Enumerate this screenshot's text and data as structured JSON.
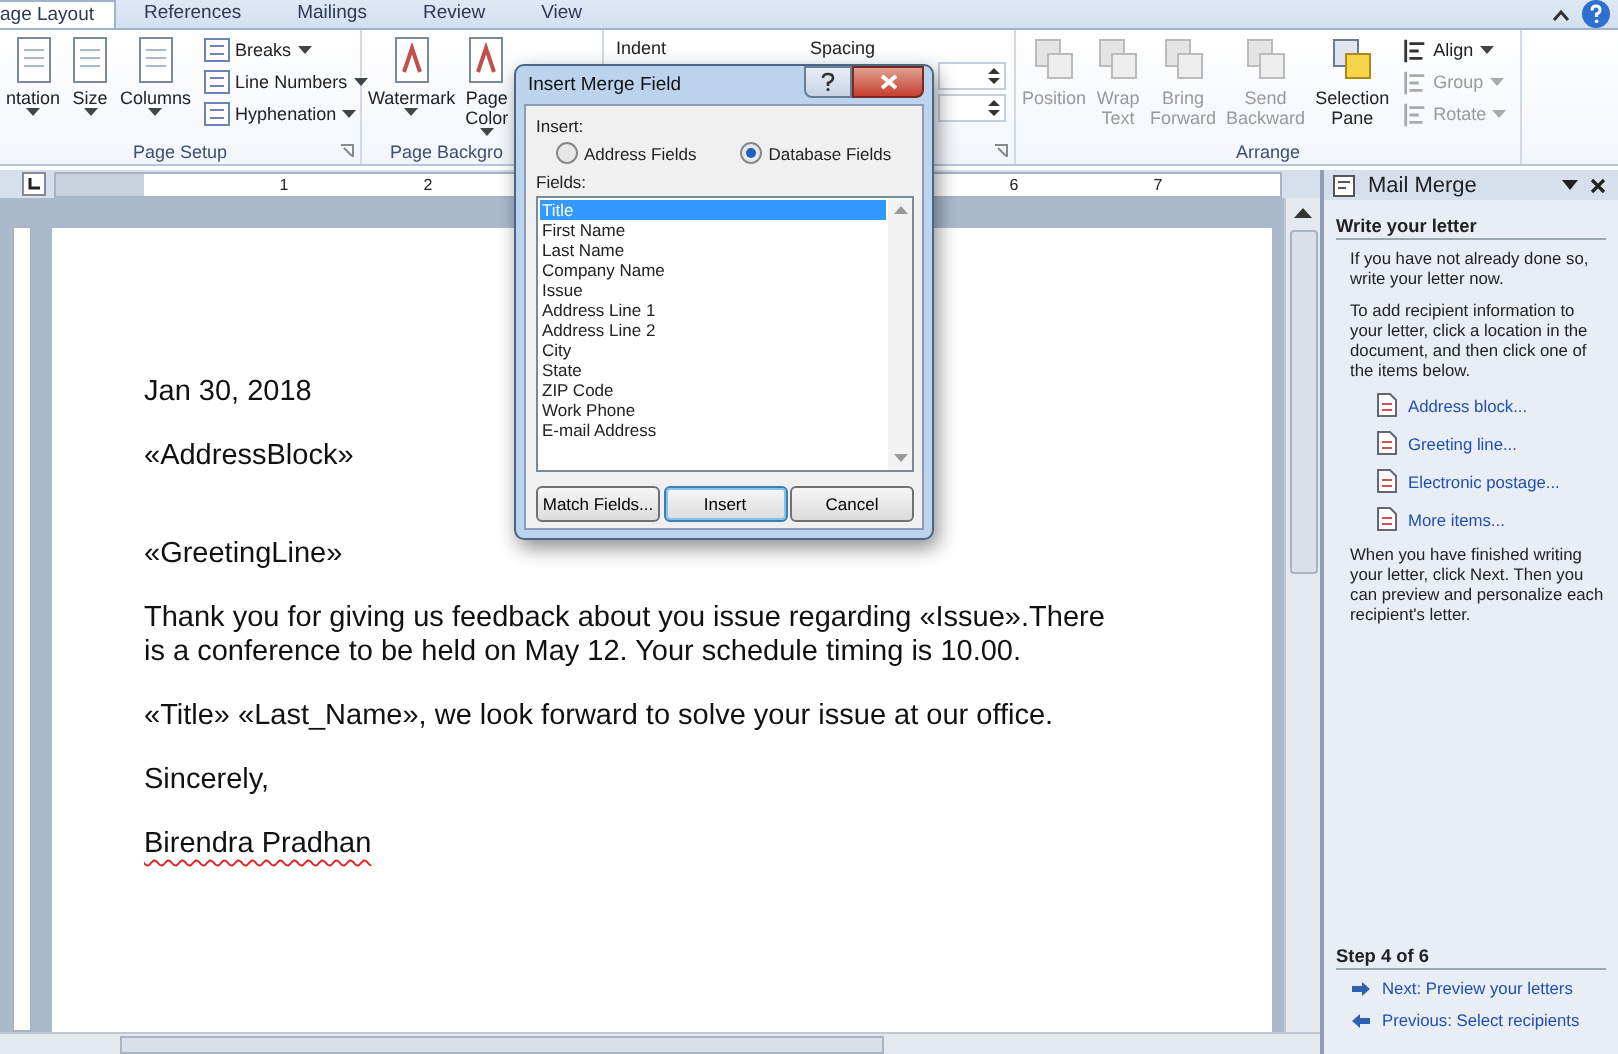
{
  "tabs": [
    {
      "label": "age Layout",
      "selected": true
    },
    {
      "label": "References",
      "selected": false
    },
    {
      "label": "Mailings",
      "selected": false
    },
    {
      "label": "Review",
      "selected": false
    },
    {
      "label": "View",
      "selected": false
    }
  ],
  "ribbon": {
    "page_setup": {
      "label": "Page Setup",
      "large": [
        {
          "label": "ntation",
          "dropdown": true
        },
        {
          "label": "Size",
          "dropdown": true
        },
        {
          "label": "Columns",
          "dropdown": true
        }
      ],
      "small": [
        {
          "label": "Breaks",
          "dropdown": true
        },
        {
          "label": "Line Numbers",
          "dropdown": true
        },
        {
          "label": "Hyphenation",
          "dropdown": true
        }
      ]
    },
    "page_background": {
      "label": "Page Backgro",
      "large": [
        {
          "label": "Watermark",
          "dropdown": true
        },
        {
          "label": "Page Color",
          "dropdown": true
        }
      ]
    },
    "paragraph": {
      "indent_label": "Indent",
      "spacing_label": "Spacing"
    },
    "arrange": {
      "label": "Arrange",
      "large": [
        {
          "label": "Position",
          "disabled": true
        },
        {
          "label": "Wrap Text",
          "disabled": true
        },
        {
          "label": "Bring Forward",
          "disabled": true
        },
        {
          "label": "Send Backward",
          "disabled": true
        },
        {
          "label": "Selection Pane",
          "disabled": false
        }
      ],
      "small": [
        {
          "label": "Align",
          "disabled": false
        },
        {
          "label": "Group",
          "disabled": true
        },
        {
          "label": "Rotate",
          "disabled": true
        }
      ]
    }
  },
  "ruler": {
    "left_numbers": [
      "1",
      "2"
    ],
    "right_numbers": [
      "6",
      "7"
    ]
  },
  "document": {
    "paragraphs": [
      {
        "text": "Jan 30, 2018",
        "spell_error": false
      },
      {
        "text": "«AddressBlock»",
        "spell_error": false
      },
      {
        "text": "«GreetingLine»",
        "spell_error": false
      },
      {
        "text": "Thank you for giving us feedback about you issue regarding «Issue».There is a conference to be held on May 12. Your schedule timing is 10.00.",
        "spell_error": false
      },
      {
        "text": "«Title» «Last_Name», we look forward to solve your issue at our office.",
        "spell_error": false
      },
      {
        "text": "Sincerely,",
        "spell_error": false
      },
      {
        "text": "Birendra Pradhan",
        "spell_error": true
      }
    ]
  },
  "dialog": {
    "title": "Insert Merge Field",
    "insert_label": "Insert:",
    "radios": [
      {
        "label": "Address Fields",
        "selected": false
      },
      {
        "label": "Database Fields",
        "selected": true
      }
    ],
    "fields_label": "Fields:",
    "fields": [
      {
        "label": "Title",
        "selected": true
      },
      {
        "label": "First Name",
        "selected": false
      },
      {
        "label": "Last Name",
        "selected": false
      },
      {
        "label": "Company Name",
        "selected": false
      },
      {
        "label": "Issue",
        "selected": false
      },
      {
        "label": "Address Line 1",
        "selected": false
      },
      {
        "label": "Address Line 2",
        "selected": false
      },
      {
        "label": "City",
        "selected": false
      },
      {
        "label": "State",
        "selected": false
      },
      {
        "label": "ZIP Code",
        "selected": false
      },
      {
        "label": "Work Phone",
        "selected": false
      },
      {
        "label": "E-mail Address",
        "selected": false
      }
    ],
    "buttons": [
      {
        "label": "Match Fields...",
        "default": false
      },
      {
        "label": "Insert",
        "default": true
      },
      {
        "label": "Cancel",
        "default": false
      }
    ]
  },
  "task_pane": {
    "title": "Mail Merge",
    "heading": "Write your letter",
    "intro": [
      "If you have not already done so, write your letter now.",
      "To add recipient information to your letter, click a location in the document, and then click one of the items below."
    ],
    "links": [
      {
        "label": "Address block..."
      },
      {
        "label": "Greeting line..."
      },
      {
        "label": "Electronic postage..."
      },
      {
        "label": "More items..."
      }
    ],
    "outro": "When you have finished writing your letter, click Next. Then you can preview and personalize each recipient's letter.",
    "step": "Step 4 of 6",
    "nav": [
      {
        "label": "Next: Preview your letters",
        "kind": "next"
      },
      {
        "label": "Previous: Select recipients",
        "kind": "previous"
      }
    ]
  }
}
